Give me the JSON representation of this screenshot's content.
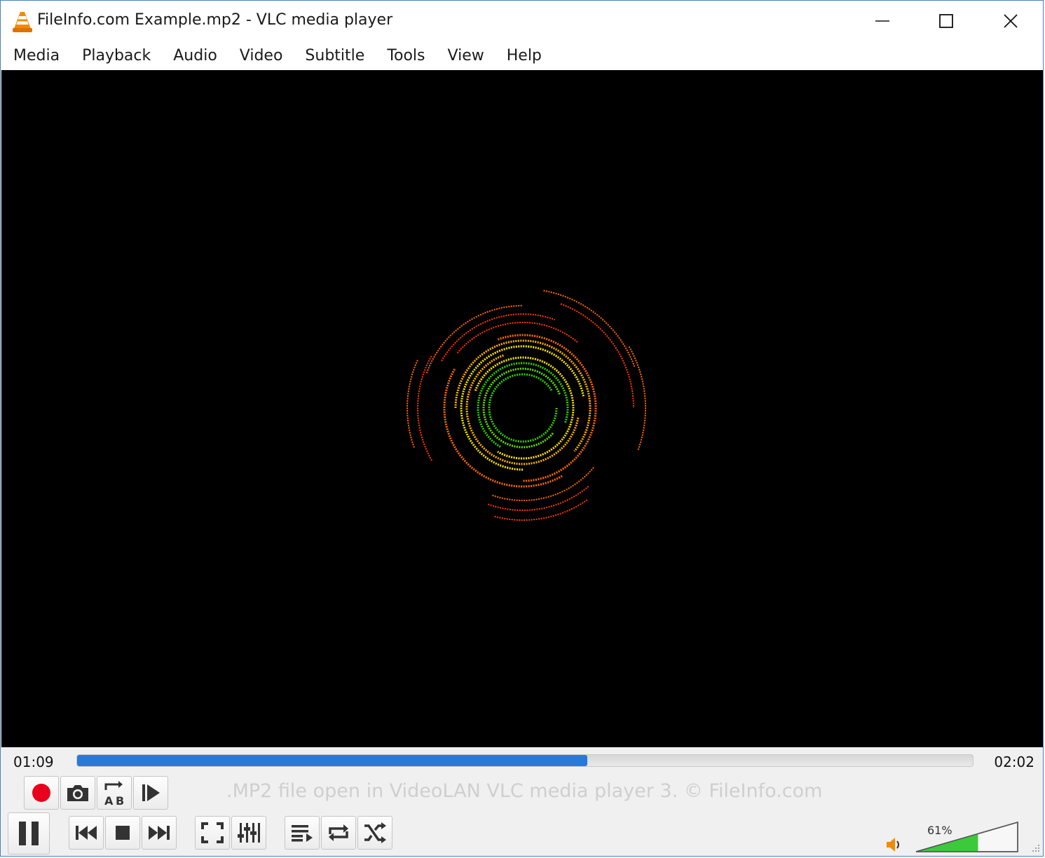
{
  "window": {
    "title": "FileInfo.com Example.mp2 - VLC media player",
    "accent": "#4a7fbd"
  },
  "titlebar_buttons": [
    "minimize-icon",
    "maximize-icon",
    "close-icon"
  ],
  "menu": [
    "Media",
    "Playback",
    "Audio",
    "Video",
    "Subtitle",
    "Tools",
    "View",
    "Help"
  ],
  "playback": {
    "elapsed": "01:09",
    "total": "02:02",
    "progress_fraction": 0.57,
    "progress_color": "#2a79d8"
  },
  "caption": ".MP2 file open in VideoLAN VLC media player 3. © FileInfo.com",
  "controls": {
    "row1": [
      "record-icon",
      "snapshot-icon",
      "ab-loop-icon",
      "frame-step-icon"
    ],
    "row2": [
      "pause-icon",
      "previous-icon",
      "stop-icon",
      "next-icon",
      "fullscreen-icon",
      "extended-settings-icon",
      "playlist-icon",
      "loop-icon",
      "shuffle-icon"
    ]
  },
  "volume": {
    "label": "61%",
    "level_fraction": 0.61,
    "fill_color": "#3cc93c"
  },
  "visualization": {
    "colors": [
      "#ff3a00",
      "#ff6a00",
      "#ffb000",
      "#ffe600",
      "#66e000",
      "#2fd000"
    ]
  }
}
